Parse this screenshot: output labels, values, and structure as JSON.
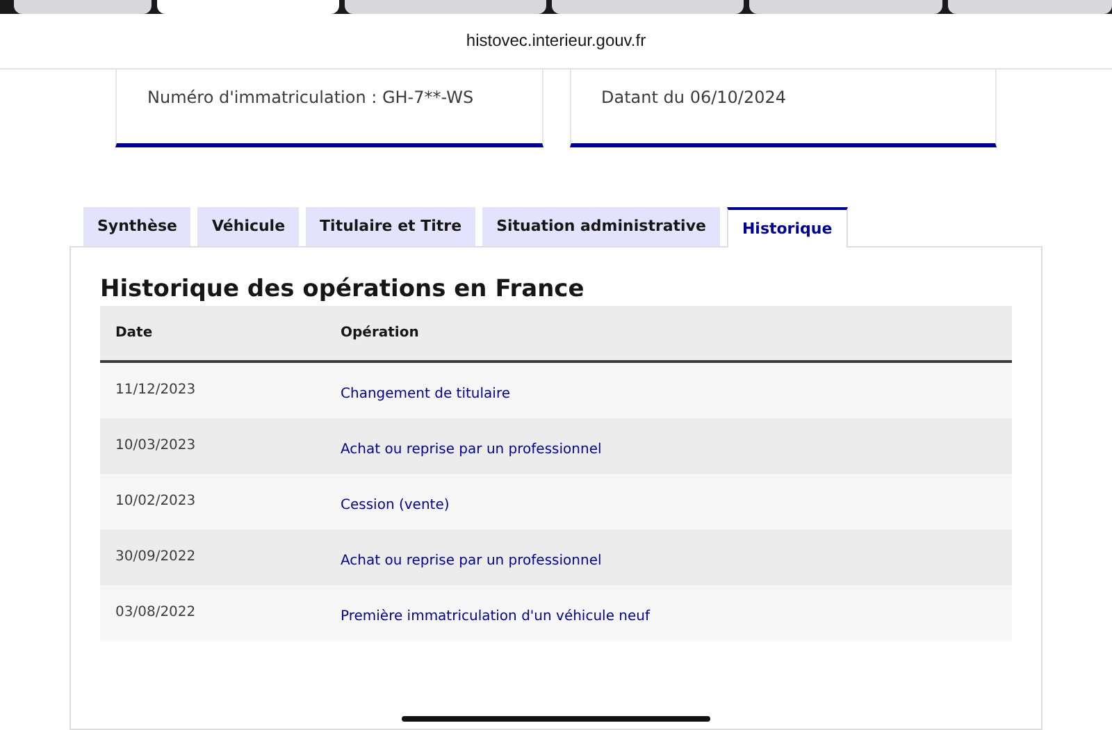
{
  "browser_tabs": [
    {
      "selected": false
    },
    {
      "selected": true
    },
    {
      "selected": false
    },
    {
      "selected": false
    },
    {
      "selected": false
    },
    {
      "selected": false
    }
  ],
  "address_bar": {
    "url": "histovec.interieur.gouv.fr"
  },
  "cards": [
    {
      "text": "Numéro d'immatriculation : GH-7**-WS"
    },
    {
      "text": "Datant du 06/10/2024"
    }
  ],
  "tabs": [
    {
      "label": "Synthèse",
      "selected": false
    },
    {
      "label": "Véhicule",
      "selected": false
    },
    {
      "label": "Titulaire et Titre",
      "selected": false
    },
    {
      "label": "Situation administrative",
      "selected": false
    },
    {
      "label": "Historique",
      "selected": true
    }
  ],
  "section": {
    "title": "Historique des opérations en France"
  },
  "table": {
    "columns": [
      "Date",
      "Opération"
    ],
    "rows": [
      {
        "date": "11/12/2023",
        "operation": "Changement de titulaire"
      },
      {
        "date": "10/03/2023",
        "operation": "Achat ou reprise par un professionnel"
      },
      {
        "date": "10/02/2023",
        "operation": "Cession (vente)"
      },
      {
        "date": "30/09/2022",
        "operation": "Achat ou reprise par un professionnel"
      },
      {
        "date": "03/08/2022",
        "operation": "Première immatriculation d'un véhicule neuf"
      }
    ]
  }
}
